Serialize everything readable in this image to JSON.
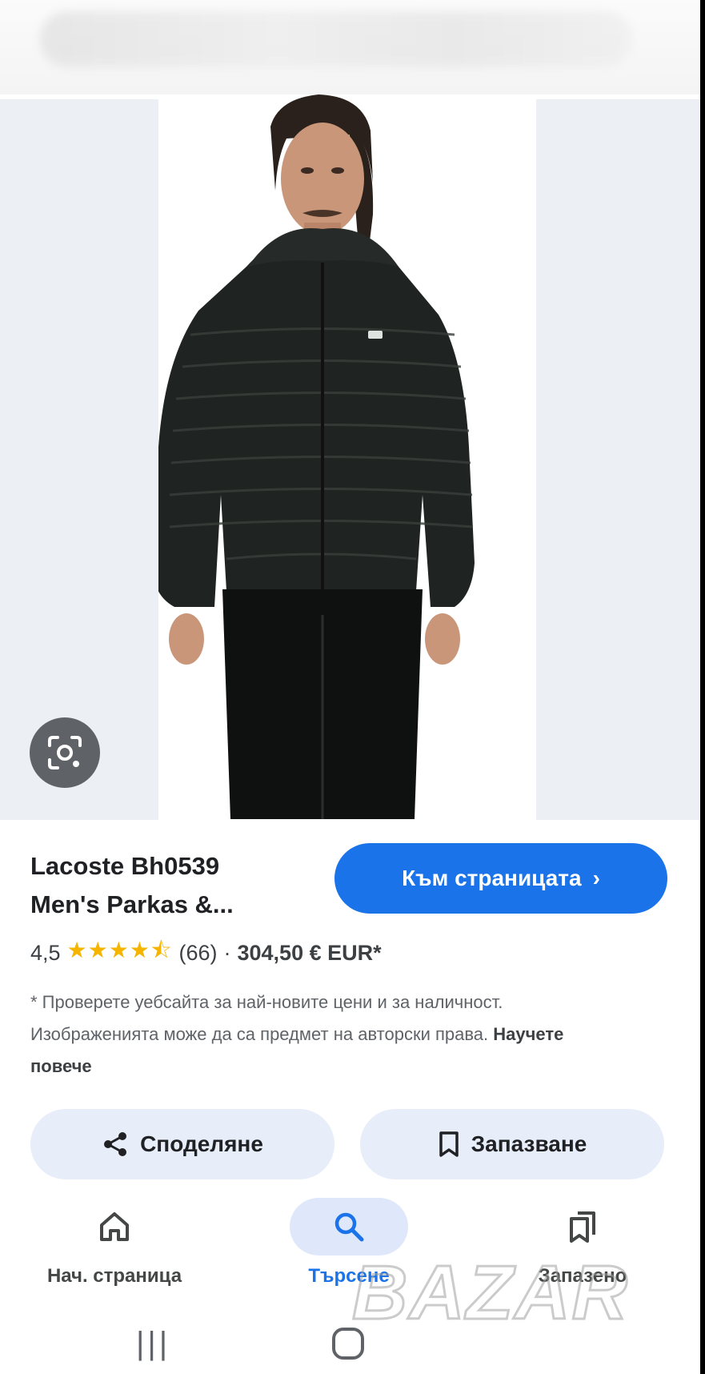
{
  "product": {
    "title_line1": "Lacoste Bh0539",
    "title_line2": "Men's Parkas &...",
    "rating": "4,5",
    "stars": "★★★★⯪",
    "review_count": "(66)",
    "separator": "·",
    "price": "304,50 € EUR*",
    "disclaimer": "* Проверете уебсайта за най-новите цени и за наличност. Изображенията може да са предмет на авторски права.",
    "learn_more": "Научете повече"
  },
  "buttons": {
    "go_to_page": "Към страницата",
    "share": "Споделяне",
    "save": "Запазване"
  },
  "nav": {
    "home": "Нач. страница",
    "search": "Търсене",
    "saved": "Запазено"
  },
  "colors": {
    "accent": "#1a73e8",
    "chip_bg": "#e8eef9",
    "star": "#f4b400"
  }
}
